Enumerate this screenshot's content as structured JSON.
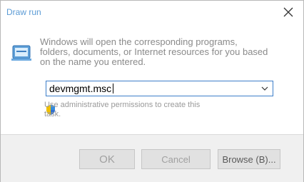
{
  "window": {
    "title": "Draw run",
    "close_icon": "close-icon"
  },
  "body": {
    "run_icon": "run-icon",
    "description": "Windows will open the corresponding programs, folders, documents, or Internet resources for you based on the name you entered.",
    "open_value": "devmgmt.msc",
    "dropdown_icon": "chevron-down-icon",
    "shield_icon": "uac-shield-icon",
    "admin_note": "Use administrative permissions to create this task."
  },
  "buttons": {
    "ok": "OK",
    "cancel": "Cancel",
    "browse": "Browse (B)..."
  },
  "colors": {
    "title_text": "#5b9bd5",
    "input_border": "#3d7ec9",
    "footer_bg": "#f0f0f0"
  }
}
